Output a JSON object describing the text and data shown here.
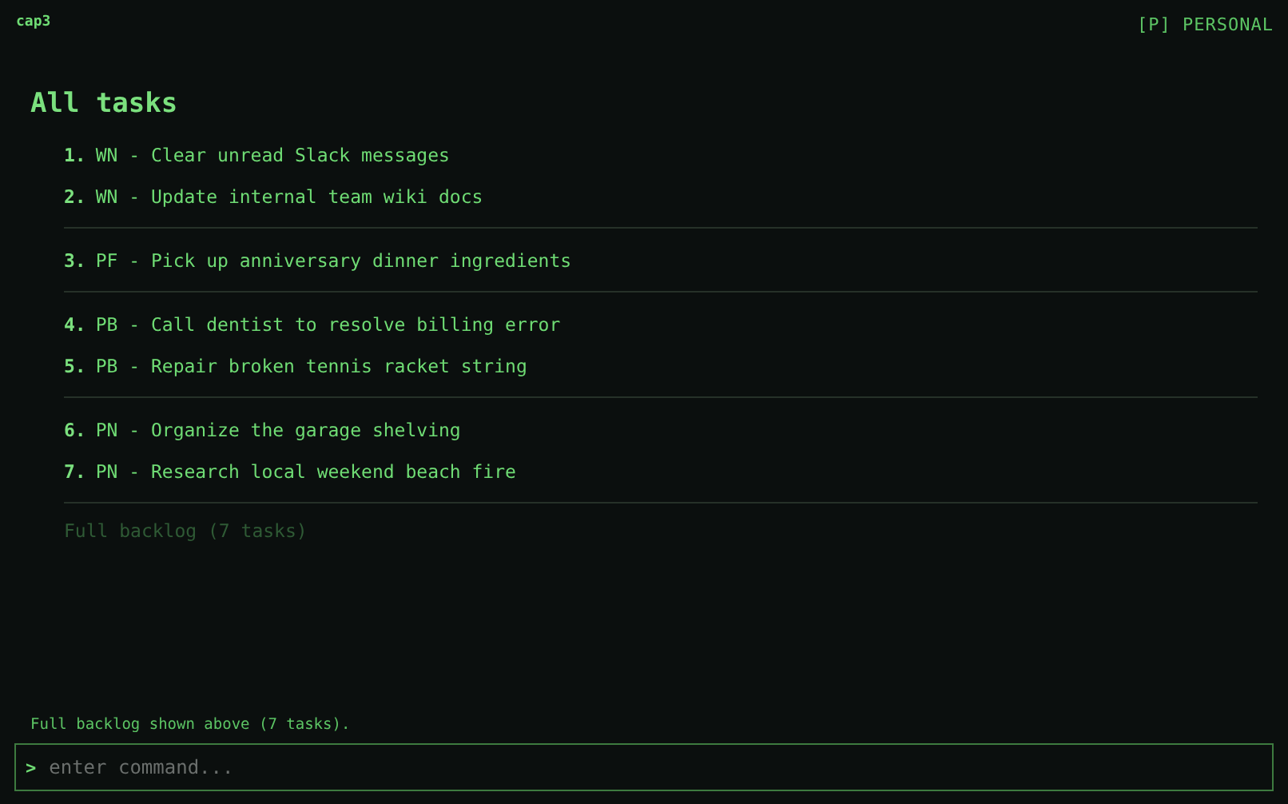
{
  "header": {
    "app_name": "cap3",
    "mode": "[P] PERSONAL"
  },
  "title": "All tasks",
  "groups": [
    {
      "tasks": [
        {
          "number": "1.",
          "text": "WN - Clear unread Slack messages"
        },
        {
          "number": "2.",
          "text": "WN - Update internal team wiki docs"
        }
      ]
    },
    {
      "tasks": [
        {
          "number": "3.",
          "text": "PF - Pick up anniversary dinner ingredients"
        }
      ]
    },
    {
      "tasks": [
        {
          "number": "4.",
          "text": "PB - Call dentist to resolve billing error"
        },
        {
          "number": "5.",
          "text": "PB - Repair broken tennis racket string"
        }
      ]
    },
    {
      "tasks": [
        {
          "number": "6.",
          "text": "PN - Organize the garage shelving"
        },
        {
          "number": "7.",
          "text": "PN - Research local weekend beach fire"
        }
      ]
    }
  ],
  "summary": "Full backlog (7 tasks)",
  "status_message": "Full backlog shown above (7 tasks).",
  "command": {
    "prompt": ">",
    "placeholder": "enter command..."
  }
}
